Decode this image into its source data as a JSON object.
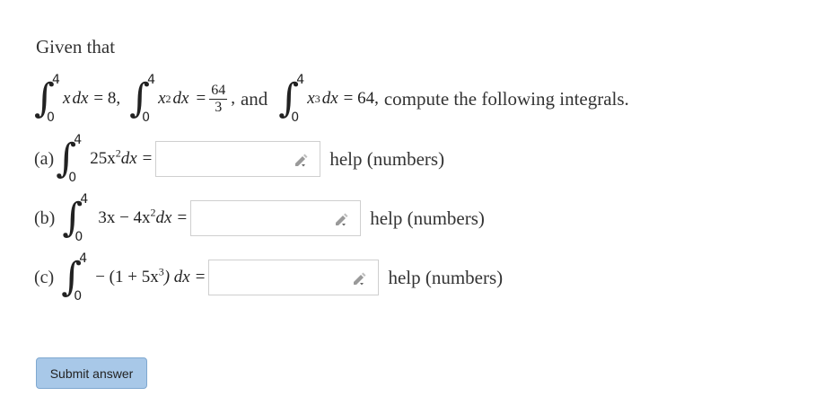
{
  "intro": "Given that",
  "given": {
    "integral_upper": "4",
    "integral_lower": "0",
    "term1_integrand": "x",
    "term1_dx": "dx",
    "term1_result": "= 8,",
    "term2_integrand": "x",
    "term2_exp": "2",
    "term2_dx": "dx",
    "term2_equals": "=",
    "term2_num": "64",
    "term2_den": "3",
    "comma": ",",
    "and": "and",
    "term3_integrand": "x",
    "term3_exp": "3",
    "term3_dx": "dx",
    "term3_result": "= 64,",
    "tail": "compute the following integrals."
  },
  "parts": [
    {
      "label": "(a)",
      "upper": "4",
      "lower": "0",
      "integrand_pre": "25x",
      "exp": "2",
      "integrand_post": "dx",
      "equals": "=",
      "answer_value": "",
      "help": "help (numbers)"
    },
    {
      "label": "(b)",
      "upper": "4",
      "lower": "0",
      "integrand_pre": "3x − 4x",
      "exp": "2",
      "integrand_post": "dx",
      "equals": "=",
      "answer_value": "",
      "help": "help (numbers)"
    },
    {
      "label": "(c)",
      "upper": "4",
      "lower": "0",
      "integrand_pre": "− (1 + 5x",
      "exp": "3",
      "integrand_post": ") dx",
      "equals": "=",
      "answer_value": "",
      "help": "help (numbers)"
    }
  ],
  "submit_label": "Submit answer",
  "icons": {
    "edit": "pencil-edit-icon"
  },
  "colors": {
    "submit_bg": "#a8c8e8",
    "submit_border": "#7fa8d0",
    "input_border": "#cfcfcf"
  }
}
